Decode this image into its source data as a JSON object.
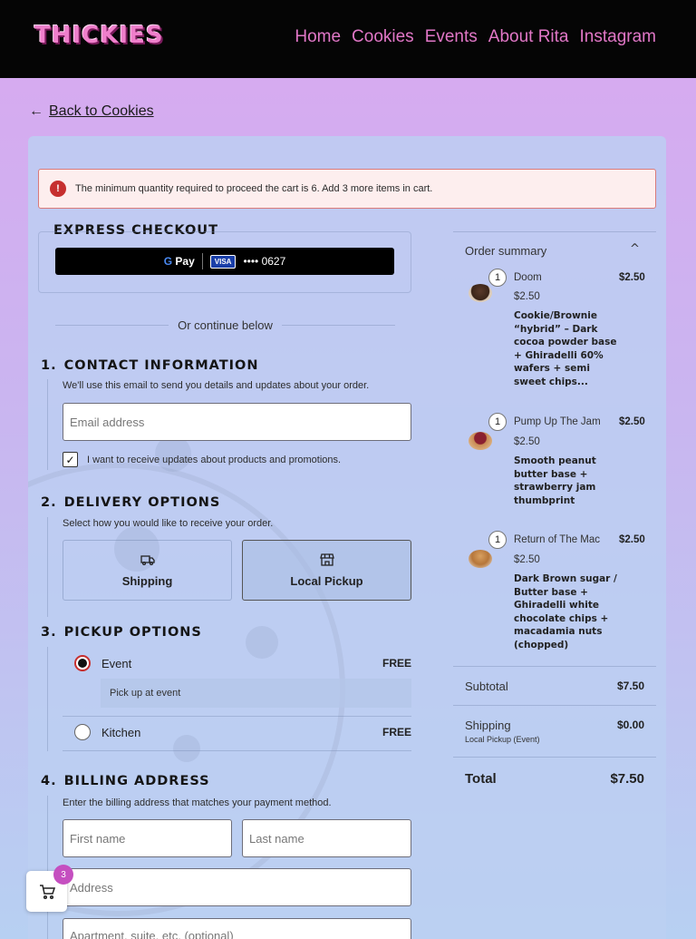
{
  "header": {
    "logo": "THICKIES",
    "nav": [
      "Home",
      "Cookies",
      "Events",
      "About Rita",
      "Instagram"
    ]
  },
  "back_link": {
    "arrow": "←",
    "label": "Back to Cookies"
  },
  "notice": {
    "icon": "alert-icon",
    "text": "The minimum quantity required to proceed the cart is 6. Add 3 more items in cart."
  },
  "express": {
    "title": "Express Checkout",
    "gpay_label": "Pay",
    "card_brand": "VISA",
    "card_mask": "•••• 0627"
  },
  "divider_text": "Or continue below",
  "contact": {
    "num": "1.",
    "title": "Contact information",
    "subtitle": "We'll use this email to send you details and updates about your order.",
    "email_placeholder": "Email address",
    "updates_label": "I want to receive updates about products and promotions.",
    "updates_checked": true
  },
  "delivery": {
    "num": "2.",
    "title": "Delivery options",
    "subtitle": "Select how you would like to receive your order.",
    "options": [
      {
        "label": "Shipping",
        "icon": "truck-icon",
        "selected": false
      },
      {
        "label": "Local Pickup",
        "icon": "store-icon",
        "selected": true
      }
    ]
  },
  "pickup": {
    "num": "3.",
    "title": "Pickup options",
    "options": [
      {
        "label": "Event",
        "price": "FREE",
        "selected": true,
        "note": "Pick up at event"
      },
      {
        "label": "Kitchen",
        "price": "FREE",
        "selected": false
      }
    ]
  },
  "billing": {
    "num": "4.",
    "title": "Billing address",
    "subtitle": "Enter the billing address that matches your payment method.",
    "first_name_placeholder": "First name",
    "last_name_placeholder": "Last name",
    "address_placeholder": "Address",
    "address2_placeholder": "Apartment, suite, etc. (optional)"
  },
  "summary": {
    "title": "Order summary",
    "chevron": "^",
    "items": [
      {
        "qty": "1",
        "name": "Doom",
        "price": "$2.50",
        "unit_price": "$2.50",
        "description": "Cookie/Brownie “hybrid” – Dark cocoa powder base + Ghiradelli 60% wafers + semi sweet chips..."
      },
      {
        "qty": "1",
        "name": "Pump Up The Jam",
        "price": "$2.50",
        "unit_price": "$2.50",
        "description": "Smooth peanut butter base + strawberry jam thumbprint"
      },
      {
        "qty": "1",
        "name": "Return of The Mac",
        "price": "$2.50",
        "unit_price": "$2.50",
        "description": "Dark Brown sugar / Butter base + Ghiradelli white chocolate chips + macadamia nuts (chopped)"
      }
    ],
    "subtotal_label": "Subtotal",
    "subtotal": "$7.50",
    "shipping_label": "Shipping",
    "shipping": "$0.00",
    "shipping_method": "Local Pickup (Event)",
    "total_label": "Total",
    "total": "$7.50"
  },
  "floating_cart": {
    "count": "3",
    "icon": "cart-icon"
  },
  "colors": {
    "header_bg": "#050505",
    "nav_link": "#e177c7",
    "logo": "#ef7fcb",
    "notice_border": "#d97a7a",
    "error_icon": "#c62f2f",
    "badge": "#c54fc0"
  }
}
